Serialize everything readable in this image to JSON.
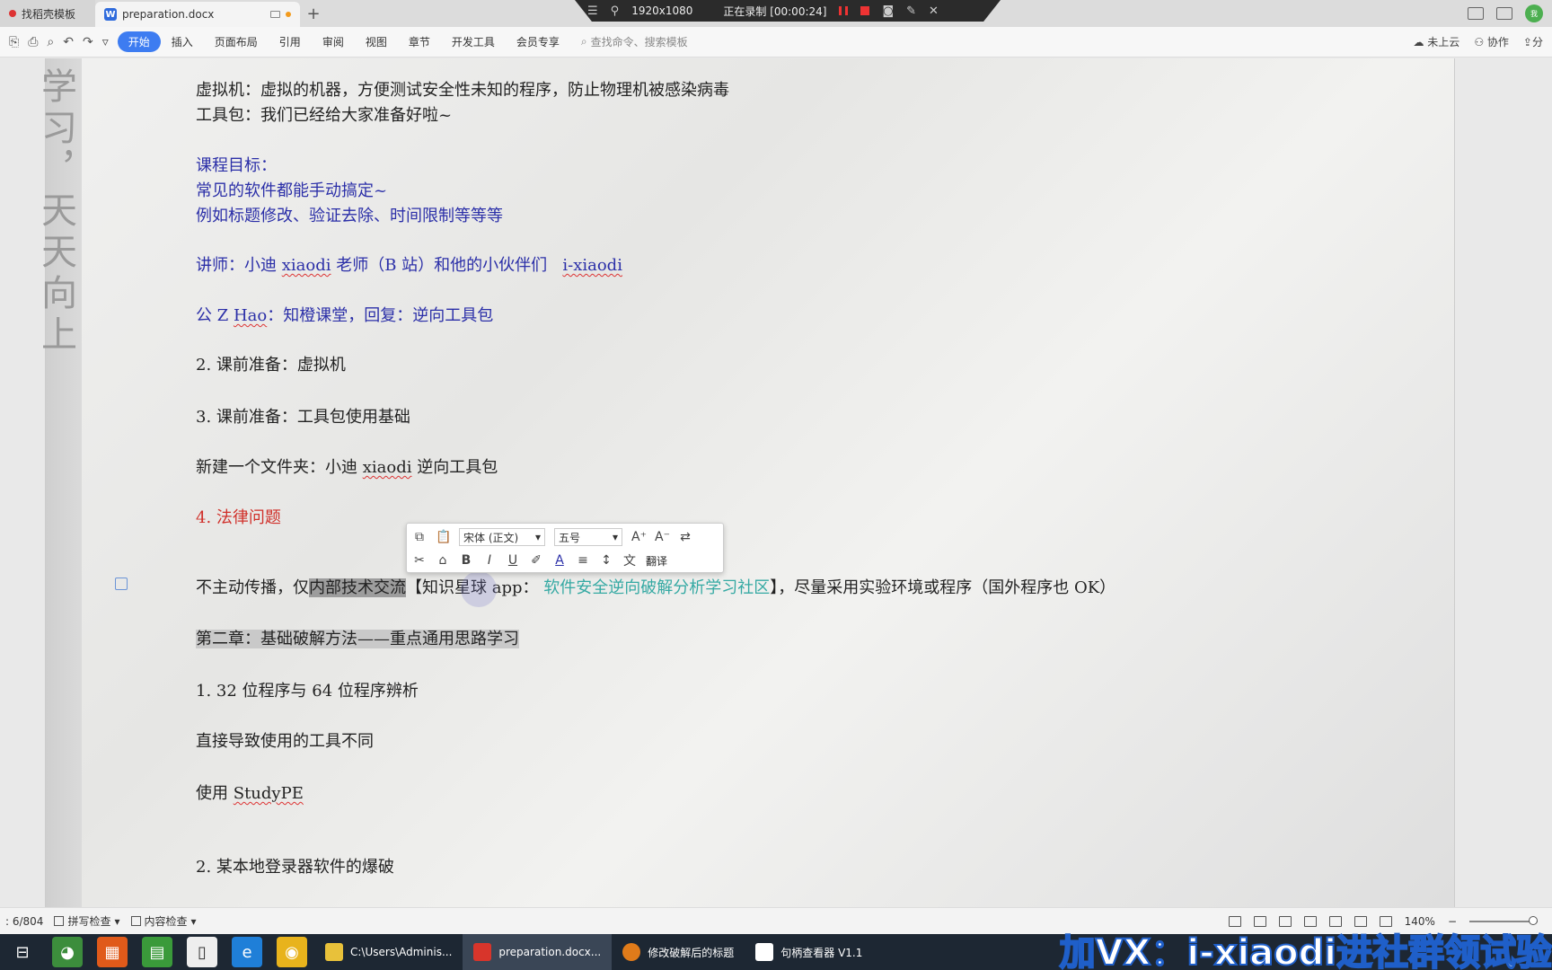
{
  "tabs": [
    {
      "title": "找稻壳模板",
      "active": false
    },
    {
      "title": "preparation.docx",
      "active": true
    }
  ],
  "recorder": {
    "resolution": "1920x1080",
    "status": "正在录制 [00:00:24]"
  },
  "ribbon": {
    "menus": [
      "开始",
      "插入",
      "页面布局",
      "引用",
      "审阅",
      "视图",
      "章节",
      "开发工具",
      "会员专享"
    ],
    "search_placeholder": "查找命令、搜索模板",
    "cloud": "未上云",
    "collab": "协作",
    "share": "分"
  },
  "calligraphy": "学习，天天向上",
  "doc": {
    "l1": "虚拟机：虚拟的机器，方便测试安全性未知的程序，防止物理机被感染病毒",
    "l2": "工具包：我们已经给大家准备好啦~",
    "l3": "课程目标：",
    "l4": "常见的软件都能手动搞定~",
    "l5": "例如标题修改、验证去除、时间限制等等等",
    "l6a": "讲师：小迪 ",
    "l6b": "xiaodi",
    "l6c": " 老师（B 站）和他的小伙伴们 ",
    "l6d": "i-xiaodi",
    "l7a": "公 Z ",
    "l7b": "Hao",
    "l7c": "：知橙课堂，回复：逆向工具包",
    "l8": "2.  课前准备：虚拟机",
    "l9": "3.  课前准备：工具包使用基础",
    "l10a": "新建一个文件夹：小迪 ",
    "l10b": "xiaodi",
    "l10c": " 逆向工具包",
    "l11": "4.  法律问题",
    "l12a": "不主动传播，仅",
    "l12b": "内部技术交流",
    "l12c": "【知识星球 app：",
    "l12d": "软件安全逆向破解分析学习社区",
    "l12e": "】，尽量采用实验环境或程序（国外程序也 OK）",
    "l13": "第二章：基础破解方法——重点通用思路学习",
    "l14": "1.  32 位程序与 64 位程序辨析",
    "l15": "直接导致使用的工具不同",
    "l16a": "使用 ",
    "l16b": "StudyPE",
    "l17": "2.  某本地登录器软件的爆破"
  },
  "mini_toolbar": {
    "font": "宋体 (正文)",
    "size": "五号",
    "translate": "翻译"
  },
  "status": {
    "page": ": 6/804",
    "spell": "拼写检查",
    "content": "内容检查",
    "zoom": "140%"
  },
  "taskbar": {
    "apps": [
      {
        "label": "C:\\Users\\Adminis..."
      },
      {
        "label": "preparation.docx..."
      },
      {
        "label": "修改破解后的标题"
      },
      {
        "label": "句柄查看器 V1.1"
      }
    ],
    "watermark": "加VX：i-xiaodi进社群领试验"
  }
}
